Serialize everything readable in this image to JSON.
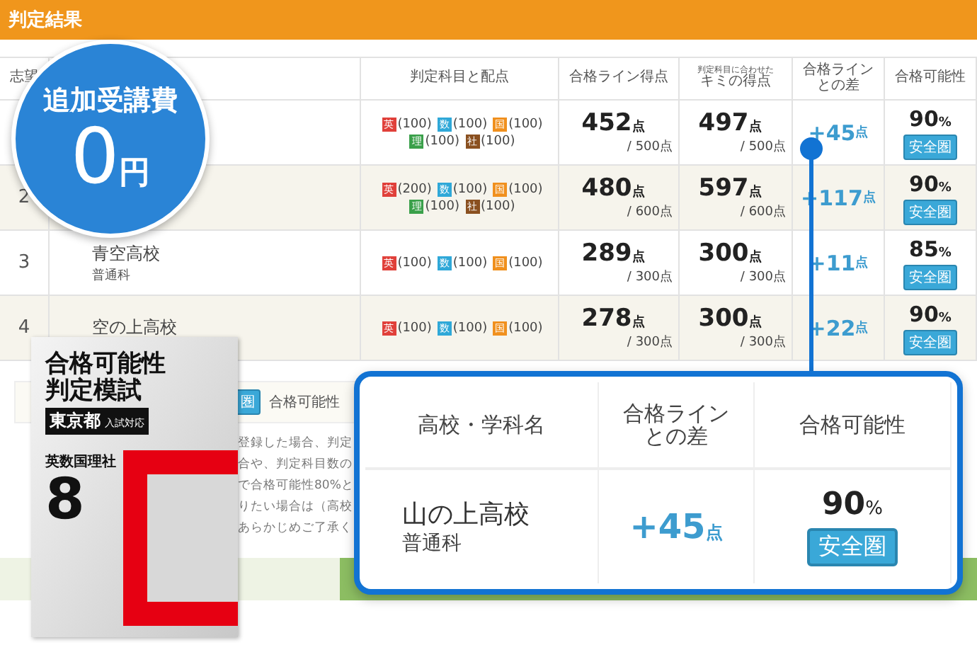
{
  "header": {
    "title": "判定結果"
  },
  "table": {
    "columns": [
      {
        "lines": [
          "志望"
        ]
      },
      {},
      {
        "lines": [
          "判定科目と配点"
        ]
      },
      {
        "lines": [
          "合格ライン得点"
        ]
      },
      {
        "note": "判定科目に合わせた",
        "lines": [
          "キミの得点"
        ]
      },
      {
        "lines": [
          "合格ライン",
          "との差"
        ]
      },
      {
        "lines": [
          "合格可能性"
        ]
      }
    ],
    "rows": [
      {
        "subjects": [
          {
            "label": "英",
            "score": "(100)",
            "color": "#e0403a"
          },
          {
            "label": "数",
            "score": "(100)",
            "color": "#2fa8d8"
          },
          {
            "label": "国",
            "score": "(100)",
            "color": "#f0901e"
          },
          {
            "label": "理",
            "score": "(100)",
            "color": "#3aa04a"
          },
          {
            "label": "社",
            "score": "(100)",
            "color": "#8a5020"
          }
        ],
        "line_score": {
          "value": "452",
          "unit": "点",
          "total": "/ 500点"
        },
        "your_score": {
          "value": "497",
          "unit": "点",
          "total": "/ 500点"
        },
        "diff": {
          "value": "+45",
          "unit": "点"
        },
        "probability": {
          "value": "90",
          "unit": "%"
        },
        "zone": "安全圏"
      },
      {
        "rank": "2",
        "subjects": [
          {
            "label": "英",
            "score": "(200)",
            "color": "#e0403a"
          },
          {
            "label": "数",
            "score": "(100)",
            "color": "#2fa8d8"
          },
          {
            "label": "国",
            "score": "(100)",
            "color": "#f0901e"
          },
          {
            "label": "理",
            "score": "(100)",
            "color": "#3aa04a"
          },
          {
            "label": "社",
            "score": "(100)",
            "color": "#8a5020"
          }
        ],
        "line_score": {
          "value": "480",
          "unit": "点",
          "total": "/ 600点"
        },
        "your_score": {
          "value": "597",
          "unit": "点",
          "total": "/ 600点"
        },
        "diff": {
          "value": "+117",
          "unit": "点"
        },
        "probability": {
          "value": "90",
          "unit": "%"
        },
        "zone": "安全圏"
      },
      {
        "rank": "3",
        "school": "青空高校",
        "course": "普通科",
        "subjects": [
          {
            "label": "英",
            "score": "(100)",
            "color": "#e0403a"
          },
          {
            "label": "数",
            "score": "(100)",
            "color": "#2fa8d8"
          },
          {
            "label": "国",
            "score": "(100)",
            "color": "#f0901e"
          }
        ],
        "line_score": {
          "value": "289",
          "unit": "点",
          "total": "/ 300点"
        },
        "your_score": {
          "value": "300",
          "unit": "点",
          "total": "/ 300点"
        },
        "diff": {
          "value": "+11",
          "unit": "点"
        },
        "probability": {
          "value": "85",
          "unit": "%"
        },
        "zone": "安全圏"
      },
      {
        "rank": "4",
        "school": "空の上高校",
        "subjects": [
          {
            "label": "英",
            "score": "(100)",
            "color": "#e0403a"
          },
          {
            "label": "数",
            "score": "(100)",
            "color": "#2fa8d8"
          },
          {
            "label": "国",
            "score": "(100)",
            "color": "#f0901e"
          }
        ],
        "line_score": {
          "value": "278",
          "unit": "点",
          "total": "/ 300点"
        },
        "your_score": {
          "value": "300",
          "unit": "点",
          "total": "/ 300点"
        },
        "diff": {
          "value": "+22",
          "unit": "点"
        },
        "probability": {
          "value": "90",
          "unit": "%"
        },
        "zone": "安全圏"
      }
    ]
  },
  "legend": {
    "badge": "圏",
    "text": "合格可能性"
  },
  "notes": [
    "登録した場合、判定",
    "合や、判定科目数の",
    "で合格可能性80%と",
    "りたい場合は（高校",
    "あらかじめご了承く"
  ],
  "badge": {
    "title": "追加受講費",
    "value": "0",
    "unit": "円"
  },
  "book": {
    "title": [
      "合格可能性",
      "判定模試"
    ],
    "region": "東京都",
    "region_note": "入試対応",
    "subjects": "英数国理社",
    "number": "8"
  },
  "callout": {
    "columns": [
      [
        "高校・学科名"
      ],
      [
        "合格ライン",
        "との差"
      ],
      [
        "合格可能性"
      ]
    ],
    "school": "山の上高校",
    "course": "普通科",
    "diff": {
      "value": "+45",
      "unit": "点"
    },
    "probability": {
      "value": "90",
      "unit": "%"
    },
    "zone": "安全圏"
  }
}
